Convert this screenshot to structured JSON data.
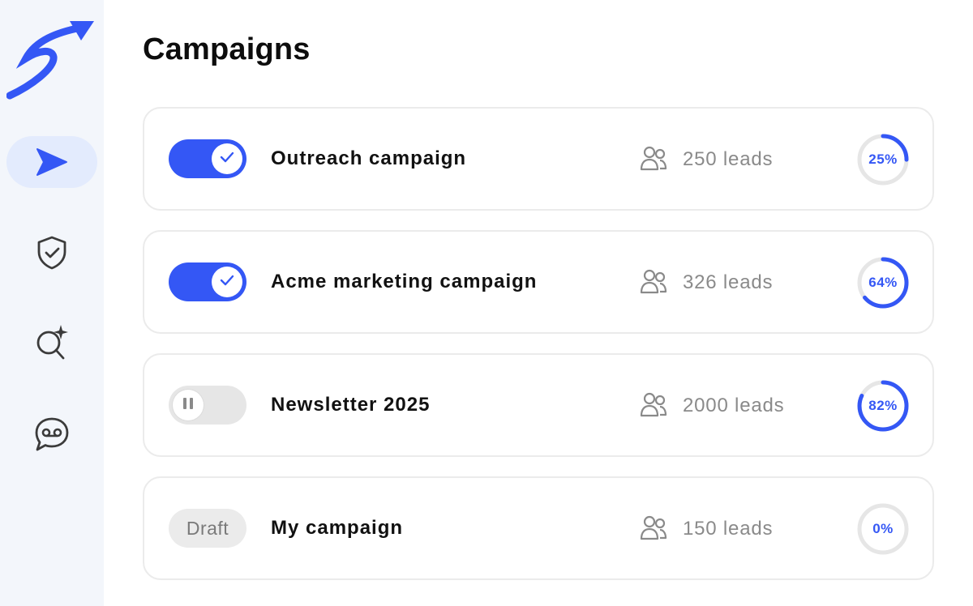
{
  "page": {
    "title": "Campaigns"
  },
  "sidebar": {
    "logo": "logo-swoosh-arrow",
    "items": [
      {
        "icon": "send-icon",
        "active": true
      },
      {
        "icon": "shield-check-icon",
        "active": false
      },
      {
        "icon": "search-sparkle-icon",
        "active": false
      },
      {
        "icon": "voicemail-chat-icon",
        "active": false
      }
    ]
  },
  "colors": {
    "accent": "#3457f5",
    "muted": "#8a8a8a",
    "track": "#e6e6e6"
  },
  "campaigns": [
    {
      "name": "Outreach campaign",
      "state": "on",
      "leads": "250 leads",
      "progress": 25,
      "progress_label": "25%"
    },
    {
      "name": "Acme marketing campaign",
      "state": "on",
      "leads": "326 leads",
      "progress": 64,
      "progress_label": "64%"
    },
    {
      "name": "Newsletter 2025",
      "state": "paused",
      "leads": "2000 leads",
      "progress": 82,
      "progress_label": "82%"
    },
    {
      "name": "My campaign",
      "state": "draft",
      "status_label": "Draft",
      "leads": "150 leads",
      "progress": 0,
      "progress_label": "0%"
    }
  ]
}
